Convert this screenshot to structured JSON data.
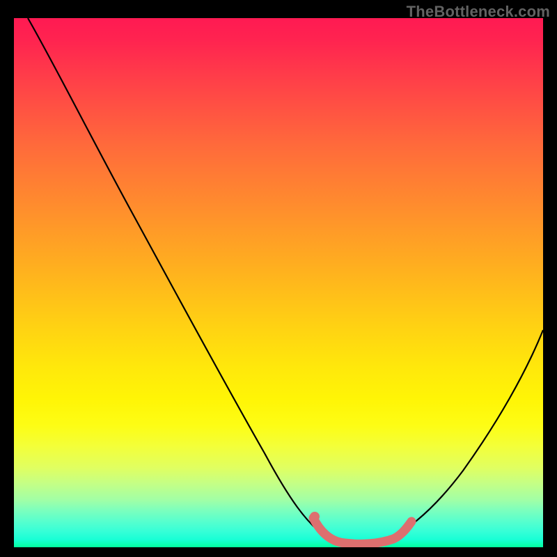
{
  "watermark": "TheBottleneck.com",
  "gradient": {
    "top": "#ff1a52",
    "bottom": "#02ff9f"
  },
  "chart_data": {
    "type": "line",
    "title": "",
    "xlabel": "",
    "ylabel": "",
    "xlim": [
      0,
      100
    ],
    "ylim": [
      0,
      100
    ],
    "grid": false,
    "note": "No axes, ticks, or numeric labels are drawn in the image; values below are fractional positions (0–100) read directly from the pixel curve.",
    "series": [
      {
        "name": "black-curve",
        "stroke": "#000000",
        "x": [
          2.6,
          10,
          20,
          30,
          40,
          47,
          52,
          56,
          60,
          64,
          68,
          72,
          78,
          85,
          92,
          100
        ],
        "y": [
          100,
          87,
          70,
          52.5,
          35,
          22,
          13.5,
          7.5,
          3.5,
          1.3,
          0.6,
          0.9,
          4,
          12,
          24,
          41
        ]
      },
      {
        "name": "pink-bottom-band",
        "stroke": "#e07070",
        "x": [
          56.5,
          58,
          60,
          63,
          66,
          69,
          71.5,
          73.5,
          75
        ],
        "y": [
          5.5,
          2.5,
          1.0,
          0.6,
          0.6,
          0.8,
          1.2,
          2.4,
          4.2
        ]
      }
    ]
  }
}
